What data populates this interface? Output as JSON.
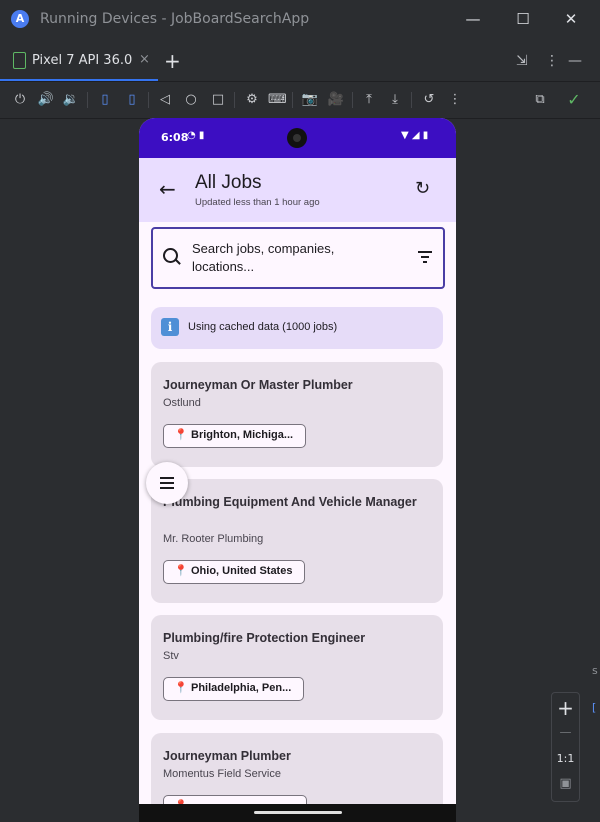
{
  "window": {
    "logo_glyph": "A",
    "title": "Running Devices - JobBoardSearchApp",
    "minimize_glyph": "—",
    "maximize_glyph": "☐",
    "close_glyph": "✕"
  },
  "tabs": {
    "device_tab_label": "Pixel 7 API 36.0",
    "close_glyph": "×",
    "add_glyph": "+",
    "right_icons": [
      "⇲",
      "⋮",
      "—"
    ]
  },
  "toolbar": {
    "icons": [
      "power-icon",
      "volume-up-icon",
      "volume-down-icon",
      "rotate-left-icon",
      "rotate-right-icon",
      "back-icon",
      "home-icon",
      "overview-icon",
      "device-settings-icon",
      "keyboard-icon",
      "screenshot-icon",
      "screen-record-icon",
      "upload-icon",
      "download-icon",
      "reset-icon",
      "more-icon",
      "inspect-icon",
      "check-icon"
    ],
    "glyphs": [
      "⏻",
      "🔊",
      "🔉",
      "▯",
      "▯",
      "◁",
      "○",
      "□",
      "⚙",
      "⌨",
      "📷",
      "🎥",
      "⤒",
      "⤓",
      "↺",
      "⋮",
      "⧉",
      "✓"
    ]
  },
  "zoom": {
    "zoom_in": "+",
    "zoom_out": "—",
    "one_to_one": "1:1",
    "fit_glyph": "▣"
  },
  "edge_fragments": [
    "s",
    "["
  ],
  "phone": {
    "status": {
      "time": "6:08",
      "left_icons": "◔ ▮",
      "right_icons": "▼ ◢ ▮"
    },
    "appbar": {
      "back_glyph": "←",
      "title": "All Jobs",
      "subtitle": "Updated less than 1 hour ago",
      "refresh_glyph": "↻"
    },
    "search": {
      "placeholder": "Search jobs, companies, locations..."
    },
    "banner": {
      "icon_glyph": "i",
      "text": "Using cached data (1000 jobs)"
    },
    "pin_glyph": "📍",
    "jobs": [
      {
        "title": "Journeyman Or Master Plumber",
        "company": "Ostlund",
        "location": "Brighton, Michiga..."
      },
      {
        "title": "Plumbing Equipment And Vehicle Manager",
        "company": "Mr. Rooter Plumbing",
        "location": "Ohio, United States"
      },
      {
        "title": "Plumbing/fire Protection Engineer",
        "company": "Stv",
        "location": "Philadelphia, Pen..."
      },
      {
        "title": "Journeyman Plumber",
        "company": "Momentus Field Service",
        "location": ""
      }
    ]
  }
}
